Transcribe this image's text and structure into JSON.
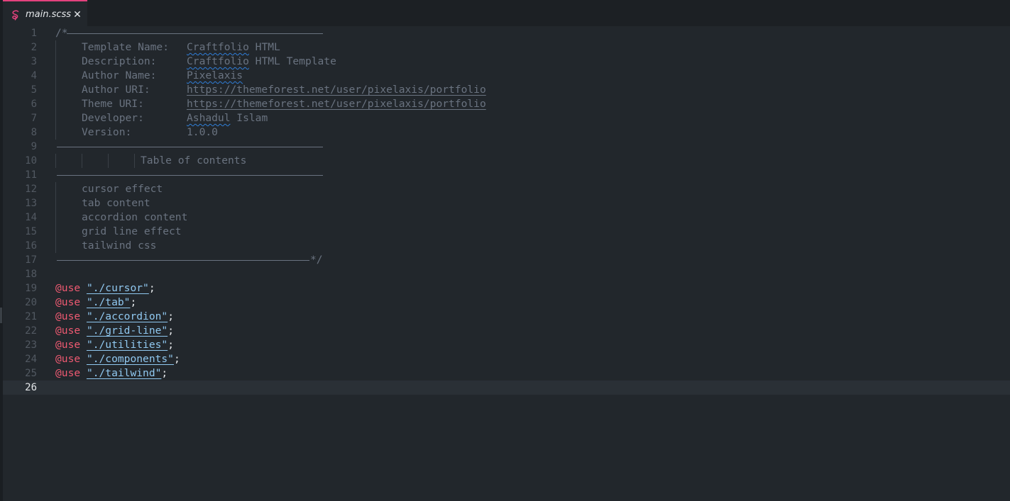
{
  "tab": {
    "title": "main.scss",
    "icon": "sass-icon",
    "close": "✕",
    "accent": "#e4427e"
  },
  "editor": {
    "current_line": 26,
    "header": {
      "open": "/*",
      "close": "*/",
      "fields": [
        {
          "key": "Template Name:",
          "value_a": "Craftfolio",
          "value_b": " HTML"
        },
        {
          "key": "Description:",
          "value_a": "Craftfolio",
          "value_b": " HTML Template"
        },
        {
          "key": "Author Name:",
          "value_a": "Pixelaxis",
          "value_b": ""
        },
        {
          "key": "Author URI:",
          "value_a": "https://themeforest.net/user/pixelaxis/portfolio",
          "value_b": ""
        },
        {
          "key": "Theme URI:",
          "value_a": "https://themeforest.net/user/pixelaxis/portfolio",
          "value_b": ""
        },
        {
          "key": "Developer:",
          "value_a": "Ashadul",
          "value_b": " Islam"
        },
        {
          "key": "Version:",
          "value_a": "1.0.0",
          "value_b": ""
        }
      ],
      "toc_title": "Table of contents",
      "toc_items": [
        "cursor effect",
        "tab content",
        "accordion content",
        "grid line effect",
        "tailwind css"
      ]
    },
    "uses": [
      {
        "keyword": "@use",
        "path": "\"./cursor\"",
        "end": ";"
      },
      {
        "keyword": "@use",
        "path": "\"./tab\"",
        "end": ";"
      },
      {
        "keyword": "@use",
        "path": "\"./accordion\"",
        "end": ";"
      },
      {
        "keyword": "@use",
        "path": "\"./grid-line\"",
        "end": ";"
      },
      {
        "keyword": "@use",
        "path": "\"./utilities\"",
        "end": ";"
      },
      {
        "keyword": "@use",
        "path": "\"./components\"",
        "end": ";"
      },
      {
        "keyword": "@use",
        "path": "\"./tailwind\"",
        "end": ";"
      }
    ],
    "line_numbers": [
      "1",
      "2",
      "3",
      "4",
      "5",
      "6",
      "7",
      "8",
      "9",
      "10",
      "11",
      "12",
      "13",
      "14",
      "15",
      "16",
      "17",
      "18",
      "19",
      "20",
      "21",
      "22",
      "23",
      "24",
      "25",
      "26"
    ]
  },
  "colors": {
    "background": "#22272c",
    "tabbar": "#1c2024",
    "comment": "#6a7380",
    "keyword": "#f05a72",
    "string": "#90c8f0",
    "spellcheck": "#2f7ed8"
  }
}
